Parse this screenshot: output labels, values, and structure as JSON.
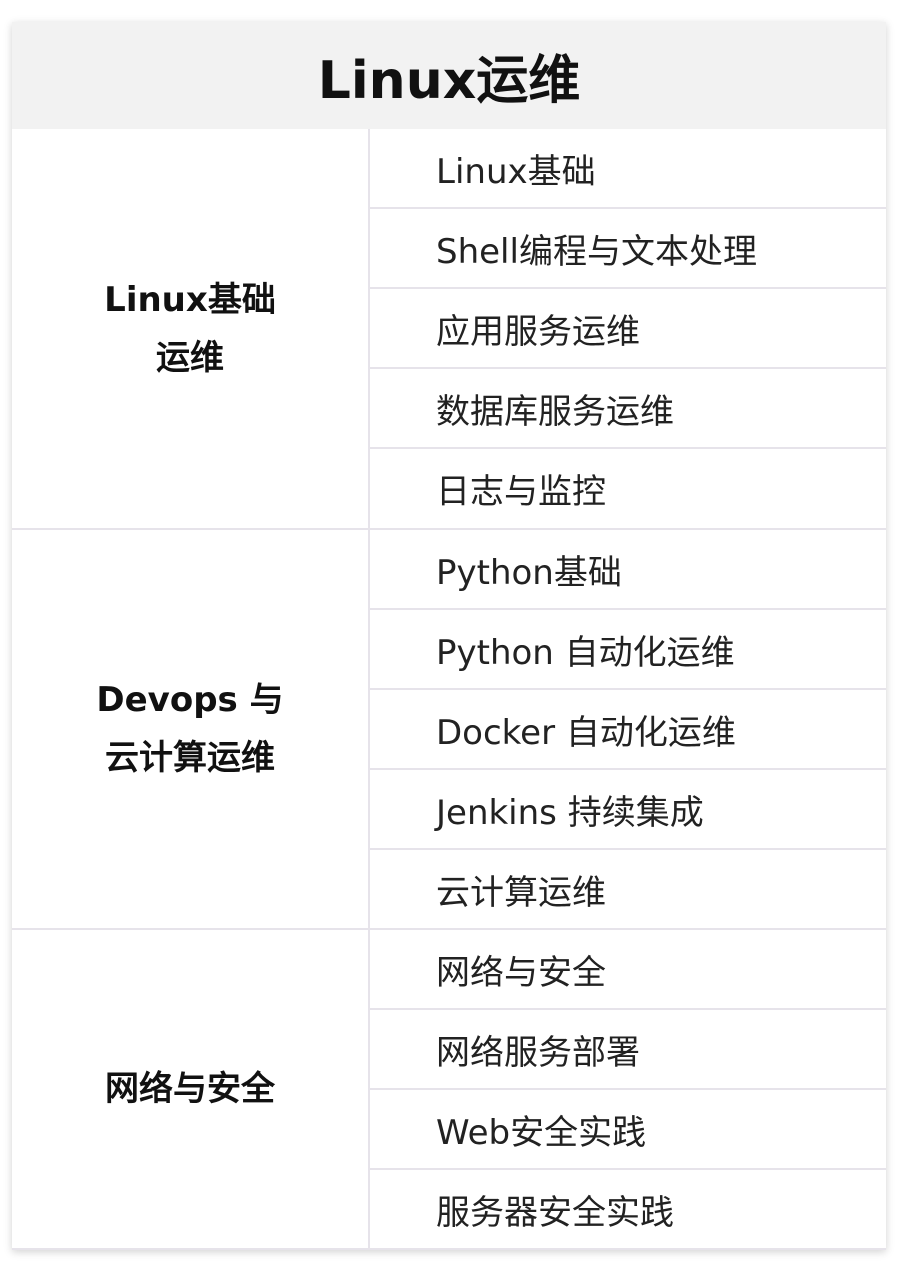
{
  "title": "Linux运维",
  "categories": [
    {
      "label": "Linux基础\n运维",
      "items": [
        "Linux基础",
        "Shell编程与文本处理",
        "应用服务运维",
        "数据库服务运维",
        "日志与监控"
      ]
    },
    {
      "label": "Devops 与\n云计算运维",
      "items": [
        "Python基础",
        "Python 自动化运维",
        "Docker 自动化运维",
        "Jenkins 持续集成",
        "云计算运维"
      ]
    },
    {
      "label": "网络与安全",
      "items": [
        "网络与安全",
        "网络服务部署",
        "Web安全实践",
        "服务器安全实践"
      ]
    }
  ]
}
